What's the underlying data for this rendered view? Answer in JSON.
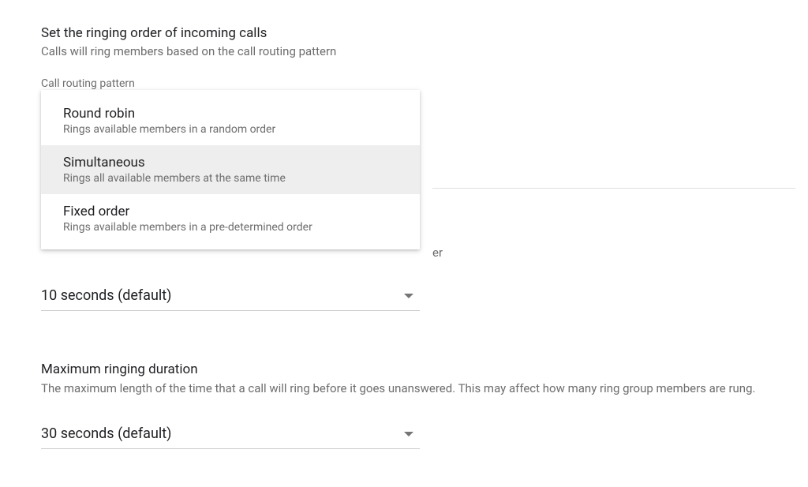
{
  "section1": {
    "heading": "Set the ringing order of incoming calls",
    "subtext": "Calls will ring members based on the call routing pattern"
  },
  "routing_pattern": {
    "label": "Call routing pattern",
    "options": [
      {
        "title": "Round robin",
        "desc": "Rings available members in a random order"
      },
      {
        "title": "Simultaneous",
        "desc": "Rings all available members at the same time"
      },
      {
        "title": "Fixed order",
        "desc": "Rings available members in a pre-determined order"
      }
    ]
  },
  "behind_fragment": "er",
  "ring_duration": {
    "value": "10 seconds (default)"
  },
  "max_duration": {
    "heading": "Maximum ringing duration",
    "desc": "The maximum length of the time that a call will ring before it goes unanswered. This may affect how many ring group members are rung.",
    "value": "30 seconds (default)"
  }
}
